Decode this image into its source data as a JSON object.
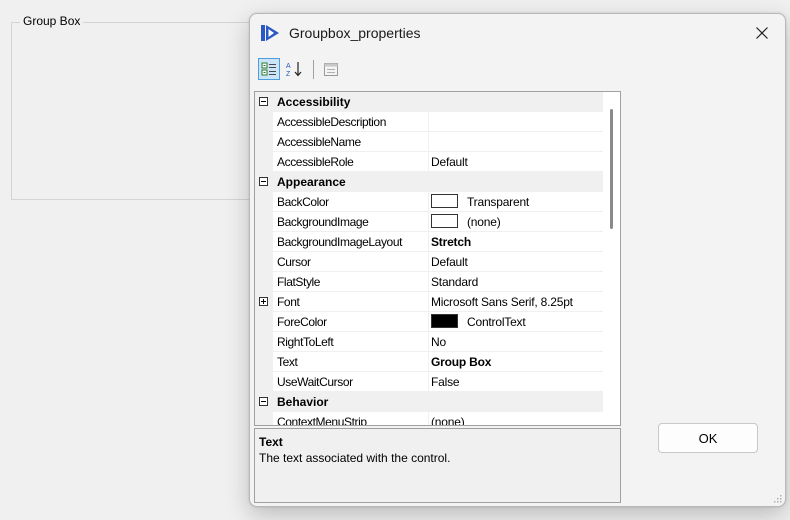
{
  "form": {
    "groupbox_label": "Group Box"
  },
  "dialog": {
    "title": "Groupbox_properties",
    "ok_label": "OK"
  },
  "toolbar": {
    "buttons": [
      {
        "icon": "categorized-icon",
        "active": true
      },
      {
        "icon": "alphabetical-sort-icon",
        "active": false
      },
      {
        "icon": "property-pages-icon",
        "active": false,
        "disabled": true
      }
    ]
  },
  "grid": {
    "rows": [
      {
        "type": "category",
        "name": "Accessibility",
        "expanded": true
      },
      {
        "type": "prop",
        "name": "AccessibleDescription",
        "value": ""
      },
      {
        "type": "prop",
        "name": "AccessibleName",
        "value": ""
      },
      {
        "type": "prop",
        "name": "AccessibleRole",
        "value": "Default"
      },
      {
        "type": "category",
        "name": "Appearance",
        "expanded": true
      },
      {
        "type": "prop",
        "name": "BackColor",
        "value": "Transparent",
        "swatch": "#ffffff"
      },
      {
        "type": "prop",
        "name": "BackgroundImage",
        "value": "(none)",
        "swatch": "#ffffff"
      },
      {
        "type": "prop",
        "name": "BackgroundImageLayout",
        "value": "Stretch",
        "bold": true
      },
      {
        "type": "prop",
        "name": "Cursor",
        "value": "Default"
      },
      {
        "type": "prop",
        "name": "FlatStyle",
        "value": "Standard"
      },
      {
        "type": "prop",
        "name": "Font",
        "value": "Microsoft Sans Serif, 8.25pt",
        "expandable": true
      },
      {
        "type": "prop",
        "name": "ForeColor",
        "value": "ControlText",
        "swatch": "#000000"
      },
      {
        "type": "prop",
        "name": "RightToLeft",
        "value": "No"
      },
      {
        "type": "prop",
        "name": "Text",
        "value": "Group Box",
        "bold": true,
        "selected": true
      },
      {
        "type": "prop",
        "name": "UseWaitCursor",
        "value": "False"
      },
      {
        "type": "category",
        "name": "Behavior",
        "expanded": true
      },
      {
        "type": "prop",
        "name": "ContextMenuStrip",
        "value": "(none)"
      }
    ]
  },
  "description": {
    "title": "Text",
    "text": "The text associated with the control."
  }
}
